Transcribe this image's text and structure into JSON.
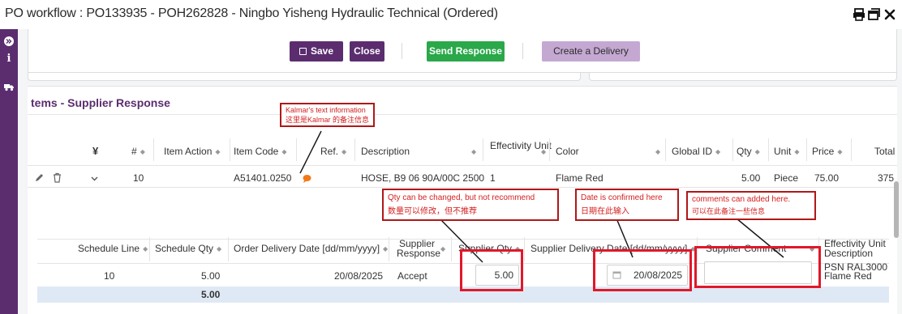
{
  "window": {
    "title": "PO workflow : PO133935 - POH262828 - Ningbo Yisheng Hydraulic Technical (Ordered)"
  },
  "toolbar": {
    "save_label": "Save",
    "close_label": "Close",
    "send_response_label": "Send Response",
    "create_delivery_label": "Create a Delivery"
  },
  "section": {
    "title": "tems - Supplier Response"
  },
  "items_table": {
    "columns": [
      "#",
      "Item Action",
      "Item Code",
      "Ref.",
      "Description",
      "Effectivity Unit",
      "Color",
      "Global ID",
      "Qty",
      "Unit",
      "Price",
      "Total"
    ],
    "row": {
      "number": "10",
      "item_code": "A51401.0250",
      "description": "HOSE, B9 06 90A/00C 2500",
      "effectivity_unit": "1",
      "color": "Flame Red",
      "qty": "5.00",
      "unit": "Piece",
      "price": "75.00",
      "total": "375"
    }
  },
  "schedule_table": {
    "columns": {
      "schedule_line": "Schedule Line",
      "schedule_qty": "Schedule Qty",
      "order_delivery_date": "Order Delivery Date [dd/mm/yyyy]",
      "supplier_response_1": "Supplier",
      "supplier_response_2": "Response",
      "supplier_qty": "Supplier Qty",
      "supplier_delivery_date": "Supplier Delivery Date [dd/mm/yyyy]",
      "supplier_comment": "Supplier Comment",
      "effectivity_unit_desc_1": "Effectivity Unit",
      "effectivity_unit_desc_2": "Description"
    },
    "row": {
      "schedule_line": "10",
      "schedule_qty": "5.00",
      "order_delivery_date": "20/08/2025",
      "supplier_response": "Accept",
      "supplier_qty": "5.00",
      "supplier_delivery_date": "20/08/2025",
      "supplier_comment": "",
      "effectivity_unit_desc_1": "PSN RAL3000",
      "effectivity_unit_desc_2": "Flame Red"
    },
    "subtotal_qty": "5.00"
  },
  "annotations": {
    "kalmar_1": "Kalmar's text information",
    "kalmar_2": "这里是Kalmar 的备注信息",
    "qty_1": "Qty can be changed, but not recommend",
    "qty_2": "数量可以修改，但不推荐",
    "date_1": "Date is confirmed here",
    "date_2": "日期在此输入",
    "comment_1": "comments can added here.",
    "comment_2": "可以在此备注一些信息"
  },
  "colors": {
    "brand_purple": "#5b2d6f",
    "send_green": "#2aa84a",
    "delivery_lilac": "#c4a8d2",
    "annotation_red": "#e0182a",
    "comment_bubble_orange": "#f07a1a"
  },
  "icons": [
    "print-icon",
    "window-icon",
    "close-icon",
    "expand-icon",
    "info-icon",
    "truck-icon",
    "pencil-icon",
    "trash-icon",
    "chevron-down-icon",
    "comment-bubble-icon",
    "calendar-icon",
    "save-icon"
  ]
}
